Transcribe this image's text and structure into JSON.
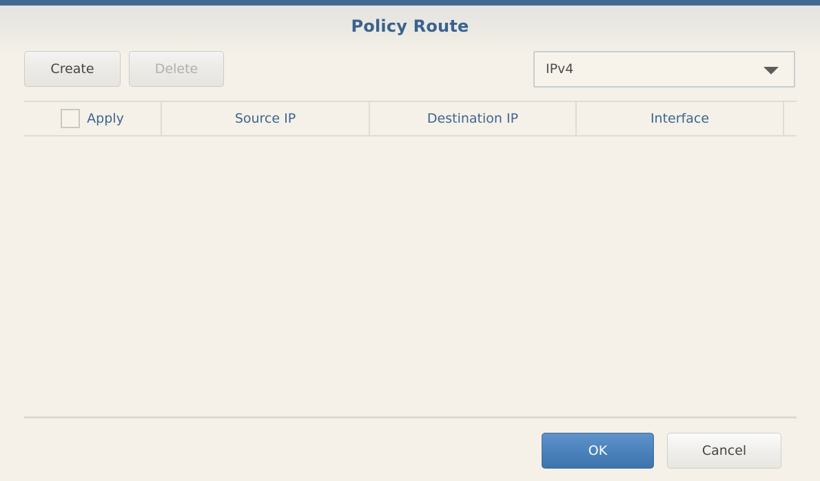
{
  "dialog": {
    "title": "Policy Route",
    "accent_bar_color": "#42688f",
    "title_color": "#3a628e",
    "background_color": "#f5f1e8"
  },
  "toolbar": {
    "create_label": "Create",
    "delete_label": "Delete",
    "delete_disabled": true,
    "protocol_select": {
      "selected": "IPv4",
      "arrow_icon": "chevron-down-icon"
    }
  },
  "table": {
    "columns": [
      {
        "id": "apply",
        "label": "Apply",
        "has_checkbox": true
      },
      {
        "id": "source_ip",
        "label": "Source IP"
      },
      {
        "id": "destination_ip",
        "label": "Destination IP"
      },
      {
        "id": "interface",
        "label": "Interface"
      }
    ],
    "header_text_color": "#3d6491",
    "select_all_checked": false,
    "rows": []
  },
  "footer": {
    "ok_label": "OK",
    "cancel_label": "Cancel",
    "ok_color": "#4a81bb"
  }
}
